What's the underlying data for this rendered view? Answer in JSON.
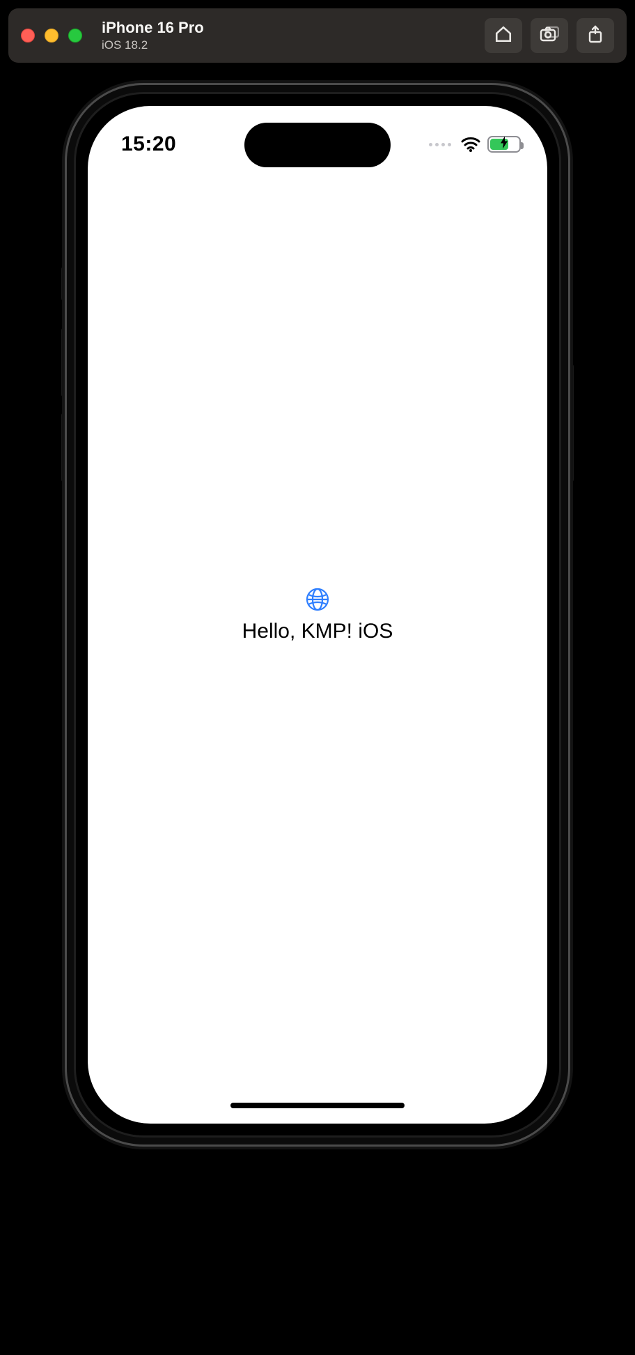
{
  "simulator": {
    "device_name": "iPhone 16 Pro",
    "os_version": "iOS 18.2",
    "actions": {
      "home": "home-icon",
      "screenshot": "screenshot-icon",
      "share": "share-icon"
    }
  },
  "status_bar": {
    "time": "15:20"
  },
  "content": {
    "greeting": "Hello, KMP! iOS"
  },
  "colors": {
    "accent": "#2f7fff",
    "battery_fill": "#34c759"
  }
}
